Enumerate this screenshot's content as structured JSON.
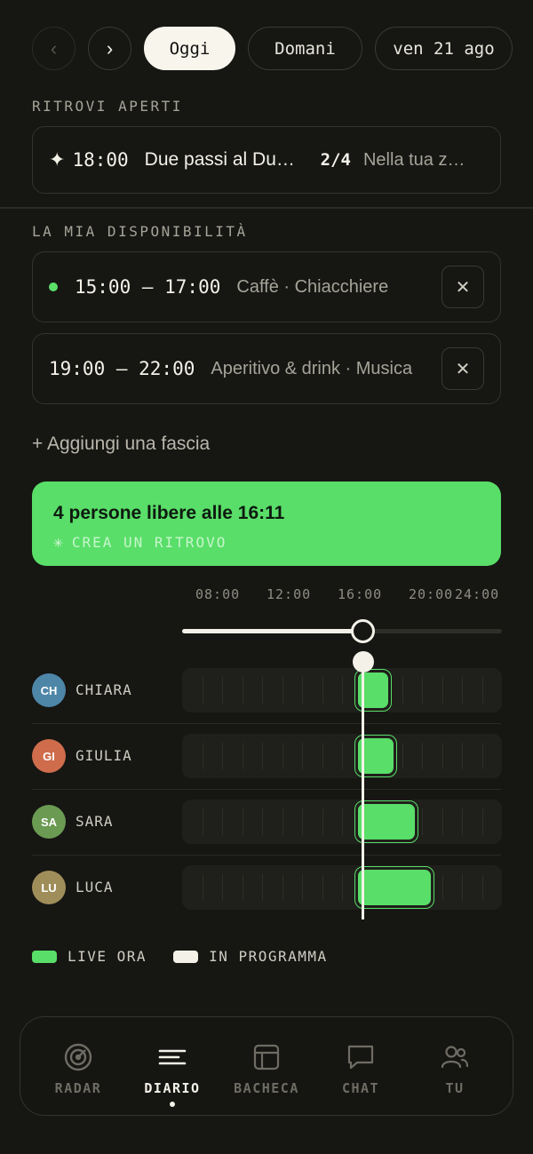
{
  "topnav": {
    "prev_icon": "chevron-left-icon",
    "next_icon": "chevron-right-icon",
    "prev_glyph": "‹",
    "next_glyph": "›",
    "today": "Oggi",
    "tomorrow": "Domani",
    "date": "ven 21 ago"
  },
  "open_meetups": {
    "label": "RITROVI APERTI",
    "items": [
      {
        "icon": "sparkle-icon",
        "glyph": "✦",
        "time": "18:00",
        "title": "Due passi al Duomo",
        "count": "2/4",
        "location": "Nella tua zona"
      }
    ]
  },
  "availability": {
    "label": "LA MIA DISPONIBILITÀ",
    "slots": [
      {
        "live": true,
        "range": "15:00 – 17:00",
        "tags": "Caffè · Chiacchiere",
        "remove": "✕"
      },
      {
        "live": false,
        "range": "19:00 – 22:00",
        "tags": "Aperitivo & drink · Musica",
        "remove": "✕"
      }
    ],
    "add_label": "+ Aggiungi una fascia"
  },
  "banner": {
    "headline": "4 persone libere alle 16:11",
    "action": "CREA UN RITROVO",
    "action_glyph": "✳",
    "color": "#59de69"
  },
  "timeline": {
    "ticks": [
      "08:00",
      "12:00",
      "16:00",
      "20:00",
      "24:00"
    ],
    "range_hours": [
      6,
      24
    ],
    "cursor_hour": 16.18,
    "people": [
      {
        "initials": "CH",
        "name": "CHIARA",
        "color": "#4e86a8",
        "start": 15.7,
        "end": 17.8
      },
      {
        "initials": "GI",
        "name": "GIULIA",
        "color": "#cf6c4b",
        "start": 15.7,
        "end": 18.1
      },
      {
        "initials": "SA",
        "name": "SARA",
        "color": "#6b9a52",
        "start": 15.7,
        "end": 19.3
      },
      {
        "initials": "LU",
        "name": "LUCA",
        "color": "#a08e5a",
        "start": 15.7,
        "end": 20.2
      }
    ]
  },
  "legend": [
    {
      "label": "LIVE ORA",
      "color": "#59de69"
    },
    {
      "label": "IN PROGRAMMA",
      "color": "#f4f2e8"
    }
  ],
  "tabs": [
    {
      "label": "RADAR",
      "icon": "radar-icon",
      "active": false
    },
    {
      "label": "DIARIO",
      "icon": "diary-lines-icon",
      "active": true
    },
    {
      "label": "BACHECA",
      "icon": "board-icon",
      "active": false
    },
    {
      "label": "CHAT",
      "icon": "chat-bubble-icon",
      "active": false
    },
    {
      "label": "TU",
      "icon": "people-icon",
      "active": false
    }
  ]
}
